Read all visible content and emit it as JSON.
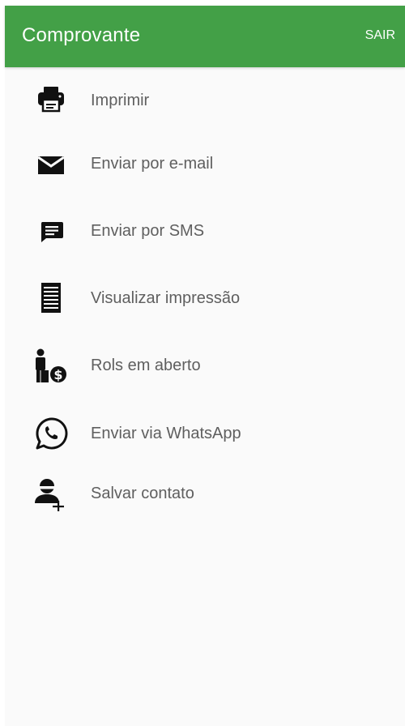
{
  "appbar": {
    "title": "Comprovante",
    "action_label": "SAIR",
    "color": "#43a047"
  },
  "menu": [
    {
      "label": "Imprimir",
      "icon": "printer-icon"
    },
    {
      "label": "Enviar por e-mail",
      "icon": "email-icon"
    },
    {
      "label": "Enviar por SMS",
      "icon": "sms-icon"
    },
    {
      "label": "Visualizar impressão",
      "icon": "document-icon"
    },
    {
      "label": "Rols em aberto",
      "icon": "person-money-icon"
    },
    {
      "label": "Enviar via WhatsApp",
      "icon": "whatsapp-icon"
    },
    {
      "label": "Salvar contato",
      "icon": "add-contact-icon"
    }
  ]
}
